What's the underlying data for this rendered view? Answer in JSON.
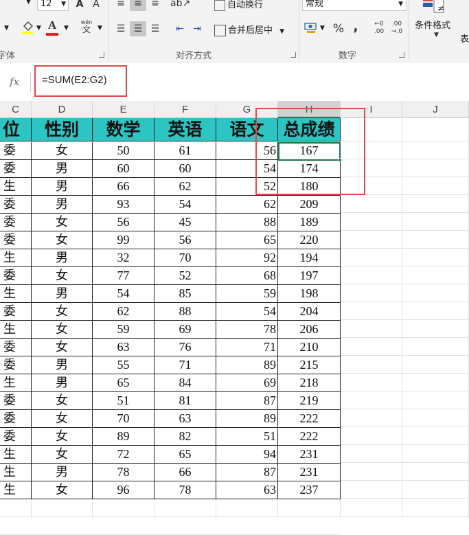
{
  "ribbon": {
    "font_size": "12",
    "bold_glyph": "A",
    "italic_glyph": "A",
    "phonetic_top": "wén",
    "phonetic_bottom": "文",
    "wrap_text": "自动换行",
    "merge_center": "合并后居中",
    "number_format": "常规",
    "percent": "%",
    "comma": ",",
    "inc_decimal_top": "←0",
    "inc_decimal_bottom": ".00",
    "dec_decimal_top": ".00",
    "dec_decimal_bottom": "→.0",
    "conditional_format": "条件格式",
    "font_group_label": "字体",
    "alignment_group_label": "对齐方式",
    "number_group_label": "数字",
    "table_partial": "表",
    "not_equal": "≠"
  },
  "formula_bar": {
    "fx": "fx",
    "formula": "=SUM(E2:G2)"
  },
  "columns": [
    {
      "key": "C",
      "label": "C"
    },
    {
      "key": "D",
      "label": "D"
    },
    {
      "key": "E",
      "label": "E"
    },
    {
      "key": "F",
      "label": "F"
    },
    {
      "key": "G",
      "label": "G"
    },
    {
      "key": "H",
      "label": "H"
    },
    {
      "key": "I",
      "label": "I"
    },
    {
      "key": "J",
      "label": "J"
    }
  ],
  "headers": {
    "c": "位",
    "d": "性别",
    "e": "数学",
    "f": "英语",
    "g": "语文",
    "h": "总成绩"
  },
  "rows": [
    {
      "c": "委",
      "d": "女",
      "e": "50",
      "f": "61",
      "g": "56",
      "h": "167"
    },
    {
      "c": "委",
      "d": "男",
      "e": "60",
      "f": "60",
      "g": "54",
      "h": "174"
    },
    {
      "c": "生",
      "d": "男",
      "e": "66",
      "f": "62",
      "g": "52",
      "h": "180"
    },
    {
      "c": "委",
      "d": "男",
      "e": "93",
      "f": "54",
      "g": "62",
      "h": "209"
    },
    {
      "c": "委",
      "d": "女",
      "e": "56",
      "f": "45",
      "g": "88",
      "h": "189"
    },
    {
      "c": "委",
      "d": "女",
      "e": "99",
      "f": "56",
      "g": "65",
      "h": "220"
    },
    {
      "c": "生",
      "d": "男",
      "e": "32",
      "f": "70",
      "g": "92",
      "h": "194"
    },
    {
      "c": "委",
      "d": "女",
      "e": "77",
      "f": "52",
      "g": "68",
      "h": "197"
    },
    {
      "c": "生",
      "d": "男",
      "e": "54",
      "f": "85",
      "g": "59",
      "h": "198"
    },
    {
      "c": "委",
      "d": "女",
      "e": "62",
      "f": "88",
      "g": "54",
      "h": "204"
    },
    {
      "c": "生",
      "d": "女",
      "e": "59",
      "f": "69",
      "g": "78",
      "h": "206"
    },
    {
      "c": "委",
      "d": "女",
      "e": "63",
      "f": "76",
      "g": "71",
      "h": "210"
    },
    {
      "c": "委",
      "d": "男",
      "e": "55",
      "f": "71",
      "g": "89",
      "h": "215"
    },
    {
      "c": "生",
      "d": "男",
      "e": "65",
      "f": "84",
      "g": "69",
      "h": "218"
    },
    {
      "c": "委",
      "d": "女",
      "e": "51",
      "f": "81",
      "g": "87",
      "h": "219"
    },
    {
      "c": "委",
      "d": "女",
      "e": "70",
      "f": "63",
      "g": "89",
      "h": "222"
    },
    {
      "c": "委",
      "d": "女",
      "e": "89",
      "f": "82",
      "g": "51",
      "h": "222"
    },
    {
      "c": "生",
      "d": "女",
      "e": "72",
      "f": "65",
      "g": "94",
      "h": "231"
    },
    {
      "c": "生",
      "d": "男",
      "e": "78",
      "f": "66",
      "g": "87",
      "h": "231"
    },
    {
      "c": "生",
      "d": "女",
      "e": "96",
      "f": "78",
      "g": "63",
      "h": "237"
    }
  ],
  "watermark": "",
  "colors": {
    "header_fill": "#2dc4c4",
    "selection": "#217346",
    "annotation": "#e04848"
  }
}
